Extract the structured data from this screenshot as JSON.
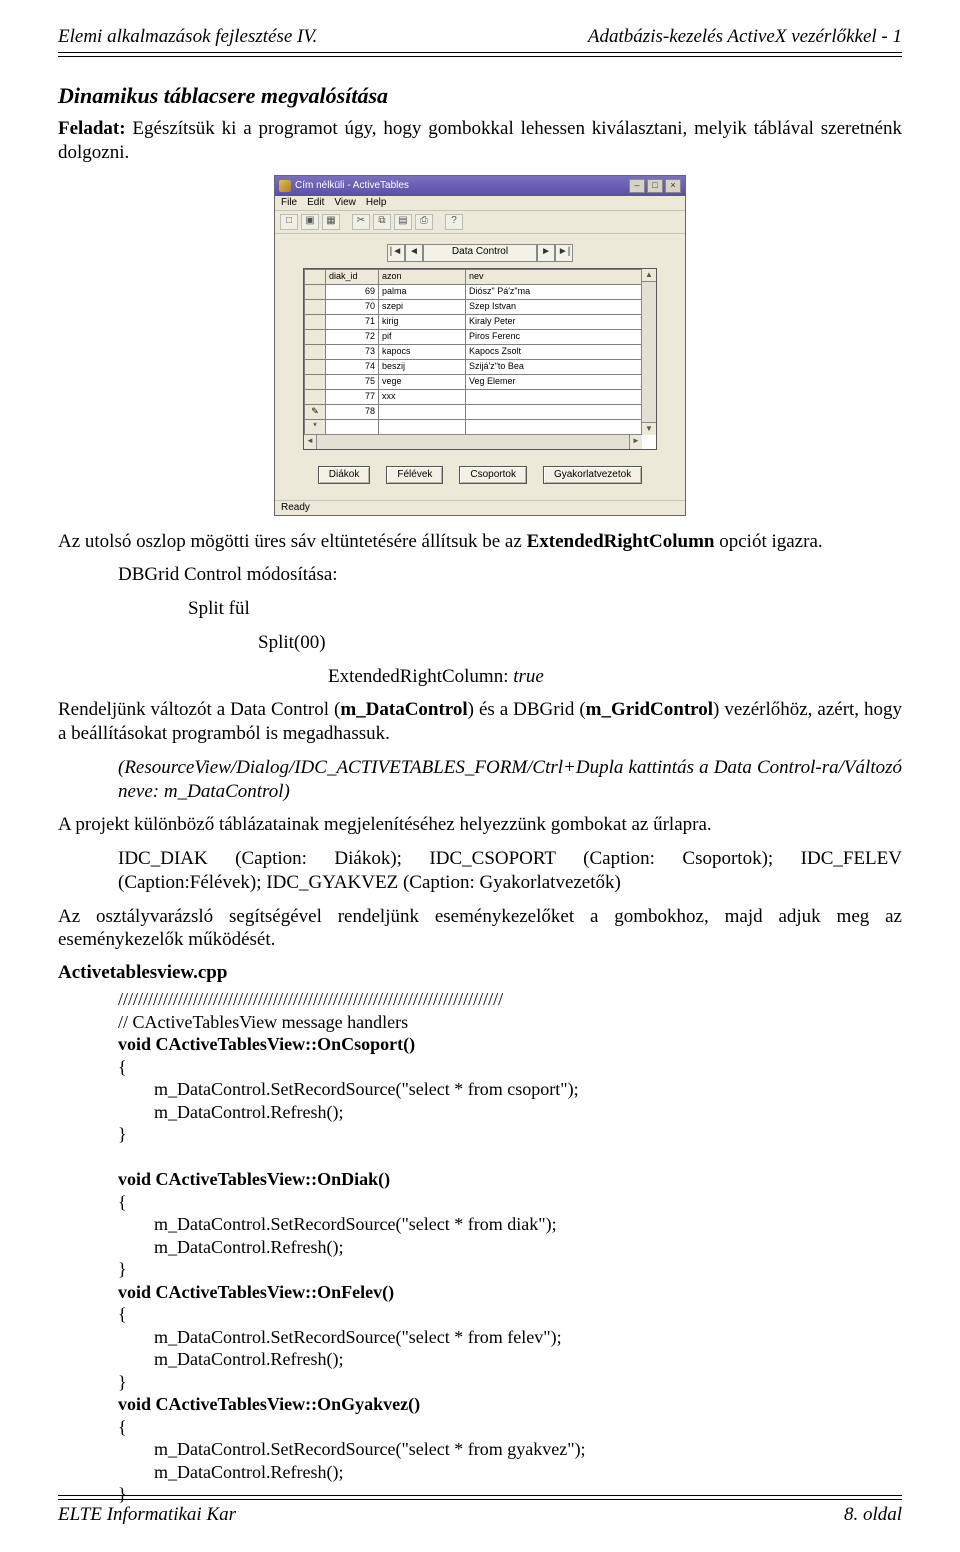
{
  "header": {
    "left": "Elemi alkalmazások fejlesztése IV.",
    "right": "Adatbázis-kezelés ActiveX vezérlőkkel - 1"
  },
  "footer": {
    "left": "ELTE Informatikai Kar",
    "right": "8. oldal"
  },
  "section_title": "Dinamikus táblacsere megvalósítása",
  "intro": {
    "feladat_label": "Feladat:",
    "feladat_text": " Egészítsük ki a programot úgy, hogy gombokkal lehessen kiválasztani, melyik táblával szeretnénk dolgozni."
  },
  "after_shot": {
    "p1_a": "Az utolsó oszlop mögötti üres sáv eltüntetésére állítsuk be az ",
    "p1_b": "ExtendedRightColumn",
    "p1_c": " opciót igazra.",
    "l1": "DBGrid Control módosítása:",
    "l2": "Split fül",
    "l3": "Split(00)",
    "l4a": "ExtendedRightColumn: ",
    "l4b": "true"
  },
  "para2": {
    "a": "Rendeljünk változót a Data Control (",
    "b": "m_DataControl",
    "c": ") és a DBGrid (",
    "d": "m_GridControl",
    "e": ") vezérlőhöz, azért, hogy a beállításokat programból is megadhassuk."
  },
  "para2b": "(ResourceView/Dialog/IDC_ACTIVETABLES_FORM/Ctrl+Dupla kattintás a Data Control-ra/Változó neve: m_DataControl)",
  "para3": "A projekt különböző táblázatainak megjelenítéséhez helyezzünk gombokat az űrlapra.",
  "para3b": "IDC_DIAK (Caption: Diákok); IDC_CSOPORT (Caption: Csoportok); IDC_FELEV (Caption:Félévek); IDC_GYAKVEZ (Caption: Gyakorlatvezetők)",
  "para4": "Az osztályvarázsló segítségével rendeljünk eseménykezelőket a gombokhoz, majd adjuk meg az eseménykezelők működését.",
  "filename": "Activetablesview.cpp",
  "code": {
    "sep": "/////////////////////////////////////////////////////////////////////////////",
    "comment": "// CActiveTablesView message handlers",
    "fn1_sig": "void CActiveTablesView::OnCsoport()",
    "fn1_b1": "m_DataControl.SetRecordSource(\"select * from csoport\");",
    "fn1_b2": "m_DataControl.Refresh();",
    "fn2_sig": "void CActiveTablesView::OnDiak()",
    "fn2_b1": "m_DataControl.SetRecordSource(\"select * from diak\");",
    "fn2_b2": "m_DataControl.Refresh();",
    "fn3_sig": "void CActiveTablesView::OnFelev()",
    "fn3_b1": "m_DataControl.SetRecordSource(\"select * from felev\");",
    "fn3_b2": "m_DataControl.Refresh();",
    "fn4_sig": "void CActiveTablesView::OnGyakvez()",
    "fn4_b1": "m_DataControl.SetRecordSource(\"select * from gyakvez\");",
    "fn4_b2": "m_DataControl.Refresh();",
    "brace_o": "{",
    "brace_c": "}"
  },
  "screenshot": {
    "title": "Cím nélküli - ActiveTables",
    "menus": [
      "File",
      "Edit",
      "View",
      "Help"
    ],
    "nav_label": "Data Control",
    "columns": [
      "",
      "diak_id",
      "azon",
      "nev"
    ],
    "col_widths": [
      "14px",
      "46px",
      "80px",
      "auto"
    ],
    "rows": [
      [
        "",
        "69",
        "palma",
        "Diósz\" Pá'z\"ma"
      ],
      [
        "",
        "70",
        "szepi",
        "Szep Istvan"
      ],
      [
        "",
        "71",
        "kirig",
        "Kiraly Peter"
      ],
      [
        "",
        "72",
        "pif",
        "Piros Ferenc"
      ],
      [
        "",
        "73",
        "kapocs",
        "Kapocs Zsolt"
      ],
      [
        "",
        "74",
        "beszij",
        "Szijá'z\"to Bea"
      ],
      [
        "",
        "75",
        "vege",
        "Veg Elemer"
      ],
      [
        "",
        "77",
        "xxx",
        ""
      ],
      [
        "✎",
        "78",
        "",
        ""
      ],
      [
        "*",
        "",
        "",
        ""
      ]
    ],
    "buttons": [
      "Diákok",
      "Félévek",
      "Csoportok",
      "Gyakorlatvezetok"
    ],
    "status": "Ready"
  }
}
